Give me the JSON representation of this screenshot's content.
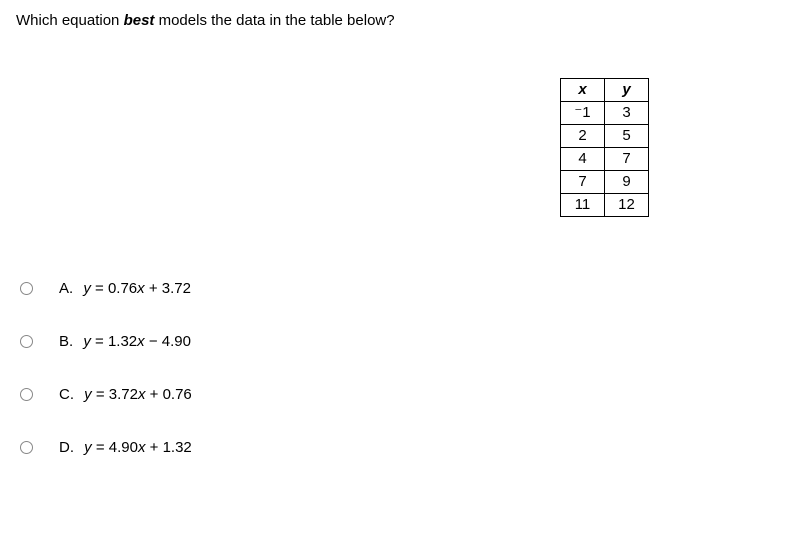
{
  "question": {
    "prefix": "Which equation ",
    "emph": "best",
    "suffix": " models the data in the table below?"
  },
  "table": {
    "headers": {
      "x": "x",
      "y": "y"
    },
    "rows": [
      {
        "x": "⁻1",
        "y": "3"
      },
      {
        "x": "2",
        "y": "5"
      },
      {
        "x": "4",
        "y": "7"
      },
      {
        "x": "7",
        "y": "9"
      },
      {
        "x": "11",
        "y": "12"
      }
    ]
  },
  "options": [
    {
      "letter": "A.",
      "var": "y",
      "eq_text": " = 0.76",
      "var2": "x",
      "tail": " + 3.72"
    },
    {
      "letter": "B.",
      "var": "y",
      "eq_text": " = 1.32",
      "var2": "x",
      "tail": " − 4.90"
    },
    {
      "letter": "C.",
      "var": "y",
      "eq_text": " = 3.72",
      "var2": "x",
      "tail": " + 0.76"
    },
    {
      "letter": "D.",
      "var": "y",
      "eq_text": " = 4.90",
      "var2": "x",
      "tail": " + 1.32"
    }
  ],
  "chart_data": {
    "type": "table",
    "columns": [
      "x",
      "y"
    ],
    "rows": [
      [
        -1,
        3
      ],
      [
        2,
        5
      ],
      [
        4,
        7
      ],
      [
        7,
        9
      ],
      [
        11,
        12
      ]
    ]
  }
}
